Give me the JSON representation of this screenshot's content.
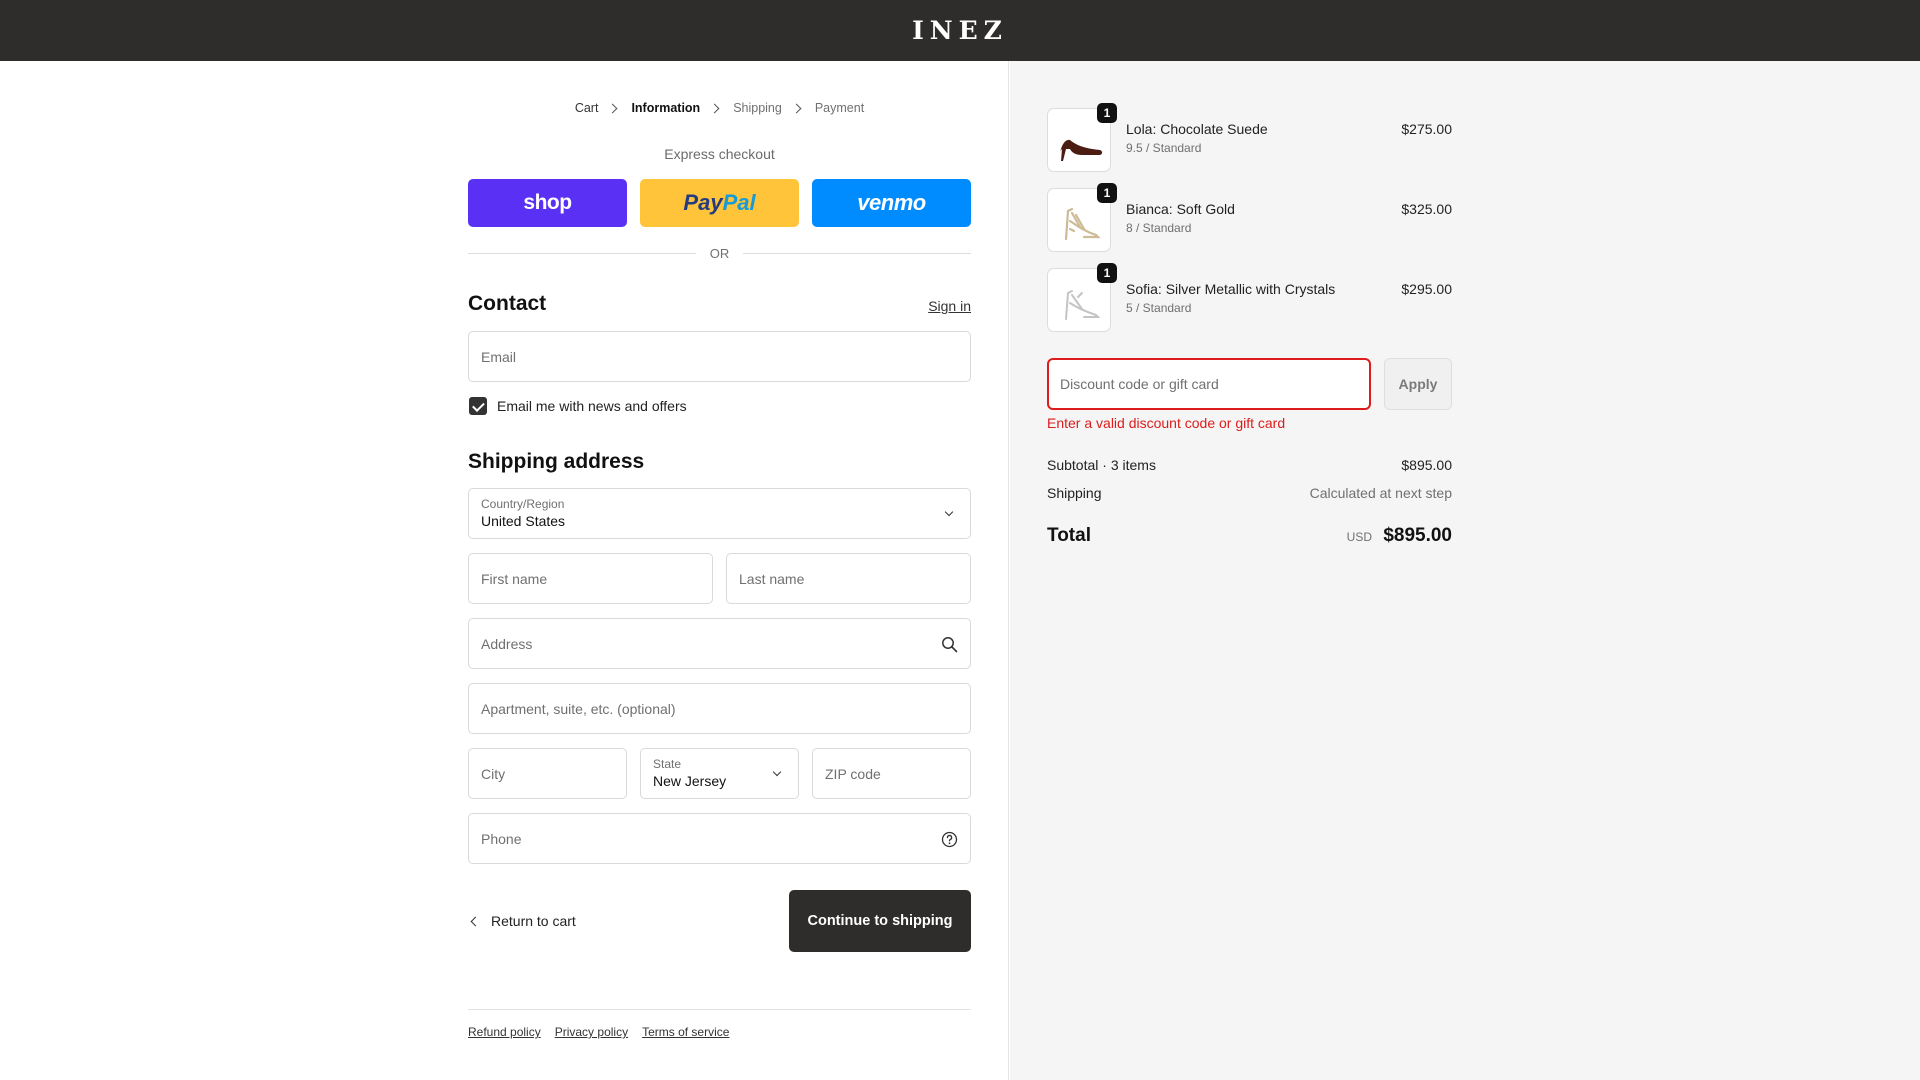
{
  "brand": {
    "logo": "INEZ"
  },
  "breadcrumb": [
    {
      "label": "Cart"
    },
    {
      "label": "Information"
    },
    {
      "label": "Shipping"
    },
    {
      "label": "Payment"
    }
  ],
  "express": {
    "title": "Express checkout",
    "shop_label": "shop",
    "paypal_label_1": "Pay",
    "paypal_label_2": "Pal",
    "venmo_label": "venmo",
    "or_label": "OR"
  },
  "contact": {
    "title": "Contact",
    "signin_label": "Sign in",
    "email_placeholder": "Email",
    "newsletter_label": "Email me with news and offers",
    "newsletter_checked": true
  },
  "shipping": {
    "title": "Shipping address",
    "country_label": "Country/Region",
    "country_value": "United States",
    "first_name_placeholder": "First name",
    "last_name_placeholder": "Last name",
    "address_placeholder": "Address",
    "apartment_placeholder": "Apartment, suite, etc. (optional)",
    "city_placeholder": "City",
    "state_label": "State",
    "state_value": "New Jersey",
    "zip_placeholder": "ZIP code",
    "phone_placeholder": "Phone"
  },
  "actions": {
    "return_label": "Return to cart",
    "continue_label": "Continue to shipping"
  },
  "footer": {
    "links": [
      "Refund policy",
      "Privacy policy",
      "Terms of service"
    ]
  },
  "cart": {
    "items": [
      {
        "name": "Lola: Chocolate Suede",
        "variant": "9.5 / Standard",
        "price": "$275.00",
        "qty": "1",
        "color": "#4a1c12"
      },
      {
        "name": "Bianca: Soft Gold",
        "variant": "8 / Standard",
        "price": "$325.00",
        "qty": "1",
        "color": "#cdbb97"
      },
      {
        "name": "Sofia: Silver Metallic with Crystals",
        "variant": "5 / Standard",
        "price": "$295.00",
        "qty": "1",
        "color": "#c4c4c4"
      }
    ],
    "discount_placeholder": "Discount code or gift card",
    "apply_label": "Apply",
    "discount_error": "Enter a valid discount code or gift card",
    "subtotal_label": "Subtotal · 3 items",
    "subtotal_value": "$895.00",
    "shipping_label": "Shipping",
    "shipping_value": "Calculated at next step",
    "total_label": "Total",
    "total_currency": "USD",
    "total_value": "$895.00"
  },
  "colors": {
    "topbar": "#2f2d2b",
    "shop": "#5a31f4",
    "paypal": "#ffc439",
    "venmo": "#008cff",
    "error": "#dd1d1d",
    "primary_button": "#2e2d2c"
  }
}
